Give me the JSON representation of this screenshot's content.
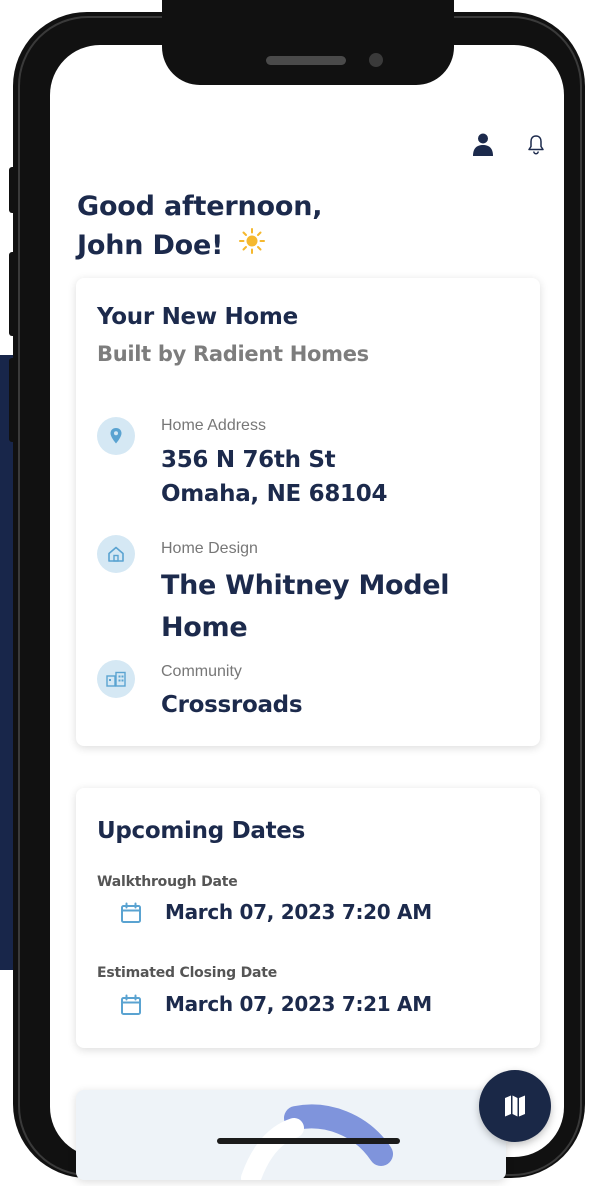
{
  "greeting": {
    "line1": "Good afternoon,",
    "line2": "John Doe!",
    "icon": "sun-icon"
  },
  "header": {
    "icons": [
      "user-icon",
      "bell-icon"
    ]
  },
  "home_card": {
    "title": "Your New Home",
    "subtitle": "Built by Radient Homes",
    "address": {
      "label": "Home Address",
      "line1": "356 N 76th St",
      "line2": "Omaha, NE 68104",
      "icon": "location-pin-icon"
    },
    "design": {
      "label": "Home Design",
      "line1": "The Whitney Model",
      "line2": "Home",
      "icon": "house-icon"
    },
    "community": {
      "label": "Community",
      "value": "Crossroads",
      "icon": "community-icon"
    }
  },
  "dates_card": {
    "title": "Upcoming Dates",
    "walkthrough": {
      "label": "Walkthrough Date",
      "value": "March 07, 2023 7:20 AM",
      "icon": "calendar-icon"
    },
    "closing": {
      "label": "Estimated Closing Date",
      "value": "March 07, 2023 7:21 AM",
      "icon": "calendar-icon"
    }
  },
  "fab": {
    "icon": "map-icon"
  },
  "colors": {
    "navy": "#1c2a4c",
    "fab": "#1a2847",
    "icon_bg": "#d5e8f4",
    "accent_blue": "#5aa3d1",
    "sun": "#f5b82e",
    "gray_text": "#7d7d7d"
  }
}
